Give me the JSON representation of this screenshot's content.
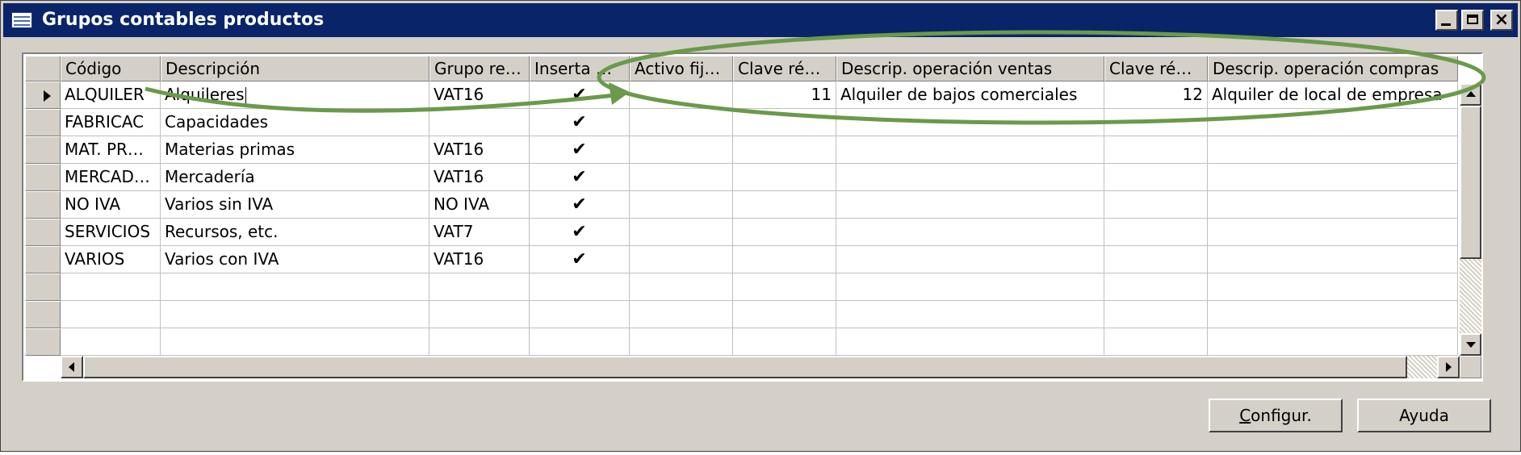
{
  "window": {
    "title": "Grupos contables productos",
    "minimize_label": "minimize",
    "maximize_label": "maximize",
    "close_label": "close"
  },
  "grid": {
    "columns": [
      {
        "key": "codigo",
        "label": "Código"
      },
      {
        "key": "descripcion",
        "label": "Descripción"
      },
      {
        "key": "grupo",
        "label": "Grupo re…"
      },
      {
        "key": "inserta",
        "label": "Inserta …"
      },
      {
        "key": "activo",
        "label": "Activo fij…"
      },
      {
        "key": "clave_v",
        "label": "Clave ré…"
      },
      {
        "key": "desc_v",
        "label": "Descrip. operación ventas"
      },
      {
        "key": "clave_c",
        "label": "Clave ré…"
      },
      {
        "key": "desc_c",
        "label": "Descrip. operación compras"
      }
    ],
    "rows": [
      {
        "codigo": "ALQUILER",
        "descripcion": "Alquileres",
        "grupo": "VAT16",
        "inserta": "✔",
        "activo": "",
        "clave_v": "11",
        "desc_v": "Alquiler de bajos comerciales",
        "clave_c": "12",
        "desc_c": "Alquiler de local de empresa"
      },
      {
        "codigo": "FABRICAC",
        "descripcion": "Capacidades",
        "grupo": "",
        "inserta": "✔",
        "activo": "",
        "clave_v": "",
        "desc_v": "",
        "clave_c": "",
        "desc_c": ""
      },
      {
        "codigo": "MAT. PR…",
        "descripcion": "Materias primas",
        "grupo": "VAT16",
        "inserta": "✔",
        "activo": "",
        "clave_v": "",
        "desc_v": "",
        "clave_c": "",
        "desc_c": ""
      },
      {
        "codigo": "MERCAD…",
        "descripcion": "Mercadería",
        "grupo": "VAT16",
        "inserta": "✔",
        "activo": "",
        "clave_v": "",
        "desc_v": "",
        "clave_c": "",
        "desc_c": ""
      },
      {
        "codigo": "NO IVA",
        "descripcion": "Varios sin IVA",
        "grupo": "NO IVA",
        "inserta": "✔",
        "activo": "",
        "clave_v": "",
        "desc_v": "",
        "clave_c": "",
        "desc_c": ""
      },
      {
        "codigo": "SERVICIOS",
        "descripcion": "Recursos, etc.",
        "grupo": "VAT7",
        "inserta": "✔",
        "activo": "",
        "clave_v": "",
        "desc_v": "",
        "clave_c": "",
        "desc_c": ""
      },
      {
        "codigo": "VARIOS",
        "descripcion": "Varios con IVA",
        "grupo": "VAT16",
        "inserta": "✔",
        "activo": "",
        "clave_v": "",
        "desc_v": "",
        "clave_c": "",
        "desc_c": ""
      },
      {
        "codigo": "",
        "descripcion": "",
        "grupo": "",
        "inserta": "",
        "activo": "",
        "clave_v": "",
        "desc_v": "",
        "clave_c": "",
        "desc_c": ""
      },
      {
        "codigo": "",
        "descripcion": "",
        "grupo": "",
        "inserta": "",
        "activo": "",
        "clave_v": "",
        "desc_v": "",
        "clave_c": "",
        "desc_c": ""
      },
      {
        "codigo": "",
        "descripcion": "",
        "grupo": "",
        "inserta": "",
        "activo": "",
        "clave_v": "",
        "desc_v": "",
        "clave_c": "",
        "desc_c": ""
      }
    ],
    "selected_row": 0
  },
  "buttons": {
    "configur_label": "Configur.",
    "configur_mnemonic": "C",
    "configur_rest": "onfigur.",
    "ayuda_label": "Ayuda"
  },
  "icons": {
    "app": "table-window-icon",
    "row_pointer": "current-row-pointer-icon",
    "check": "checkmark-icon"
  },
  "colors": {
    "titlebar": "#0a246a",
    "window_bg": "#d4d0c8",
    "annotation": "#6a9a4a"
  }
}
